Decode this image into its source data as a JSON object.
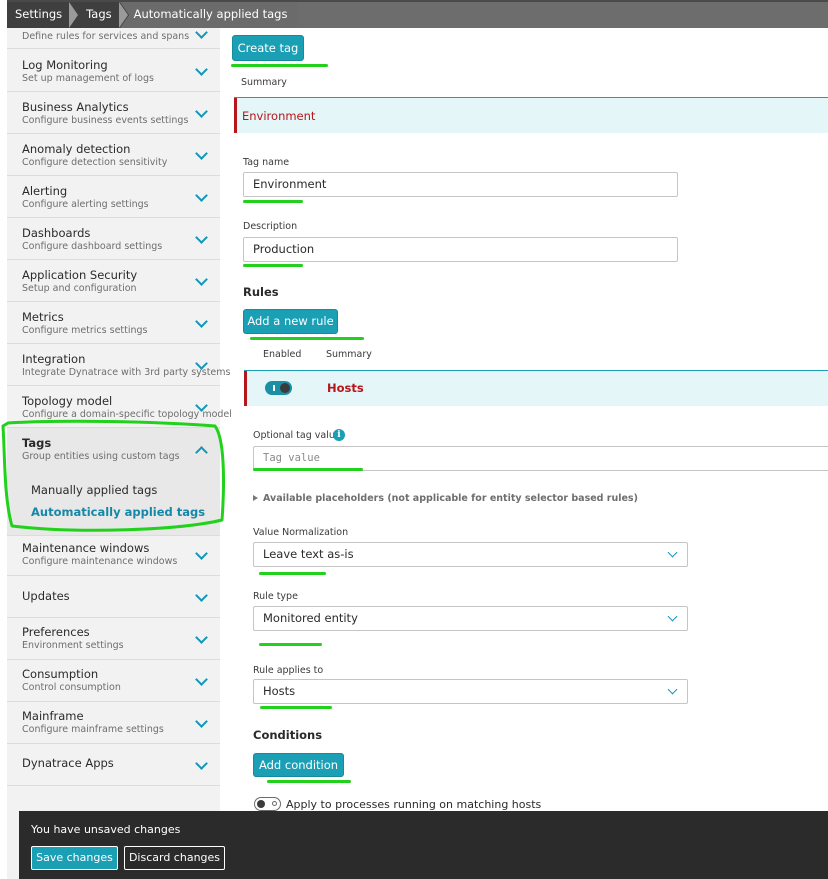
{
  "breadcrumb": [
    "Settings",
    "Tags",
    "Automatically applied tags"
  ],
  "sidebar": {
    "partial_item": {
      "subtitle": "Define rules for services and spans"
    },
    "items": [
      {
        "title": "Log Monitoring",
        "subtitle": "Set up management of logs"
      },
      {
        "title": "Business Analytics",
        "subtitle": "Configure business events settings"
      },
      {
        "title": "Anomaly detection",
        "subtitle": "Configure detection sensitivity"
      },
      {
        "title": "Alerting",
        "subtitle": "Configure alerting settings"
      },
      {
        "title": "Dashboards",
        "subtitle": "Configure dashboard settings"
      },
      {
        "title": "Application Security",
        "subtitle": "Setup and configuration"
      },
      {
        "title": "Metrics",
        "subtitle": "Configure metrics settings"
      },
      {
        "title": "Integration",
        "subtitle": "Integrate Dynatrace with 3rd party systems"
      },
      {
        "title": "Topology model",
        "subtitle": "Configure a domain-specific topology model"
      }
    ],
    "tags": {
      "title": "Tags",
      "subtitle": "Group entities using custom tags",
      "children": [
        "Manually applied tags",
        "Automatically applied tags"
      ]
    },
    "items_after": [
      {
        "title": "Maintenance windows",
        "subtitle": "Configure maintenance windows"
      },
      {
        "title": "Updates",
        "subtitle": ""
      },
      {
        "title": "Preferences",
        "subtitle": "Environment settings"
      },
      {
        "title": "Consumption",
        "subtitle": "Control consumption"
      },
      {
        "title": "Mainframe",
        "subtitle": "Configure mainframe settings"
      },
      {
        "title": "Dynatrace Apps",
        "subtitle": ""
      }
    ]
  },
  "main": {
    "create_tag_label": "Create tag",
    "summary_header": "Summary",
    "summary_row": "Environment",
    "tag_name_label": "Tag name",
    "tag_name_value": "Environment",
    "description_label": "Description",
    "description_value": "Production",
    "rules_heading": "Rules",
    "add_rule_label": "Add a new rule",
    "rules_col_enabled": "Enabled",
    "rules_col_summary": "Summary",
    "rule_summary": "Hosts",
    "optional_value_label": "Optional tag value",
    "optional_value_placeholder": "Tag value",
    "placeholders_label": "Available placeholders (not applicable for entity selector based rules)",
    "value_norm_label": "Value Normalization",
    "value_norm_value": "Leave text as-is",
    "rule_type_label": "Rule type",
    "rule_type_value": "Monitored entity",
    "applies_to_label": "Rule applies to",
    "applies_to_value": "Hosts",
    "conditions_heading": "Conditions",
    "add_condition_label": "Add condition",
    "apply_processes_label": "Apply to processes running on matching hosts"
  },
  "toast": {
    "message": "You have unsaved changes",
    "save_label": "Save changes",
    "discard_label": "Discard changes"
  },
  "colors": {
    "accent": "#1a9fb5",
    "alert_red": "#b4161b",
    "annotation_green": "#22d11b"
  }
}
